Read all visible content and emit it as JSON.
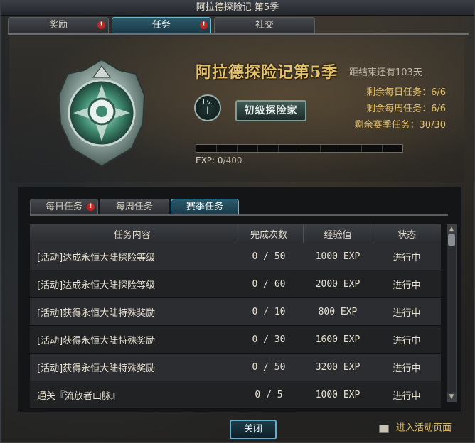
{
  "window": {
    "title": "阿拉德探险记 第5季"
  },
  "top_tabs": [
    {
      "label": "奖励",
      "alert": "!"
    },
    {
      "label": "任务",
      "alert": "!"
    },
    {
      "label": "社交"
    }
  ],
  "header": {
    "season_title": "阿拉德探险记第5季",
    "ends_in": "距结束还有103天",
    "level_label": "Lv.",
    "level_value": "I",
    "rank_name": "初级探险家",
    "remaining": [
      {
        "label": "剩余每日任务：",
        "value": "6/6"
      },
      {
        "label": "剩余每周任务：",
        "value": "6/6"
      },
      {
        "label": "剩余赛季任务：",
        "value": "30/30"
      }
    ],
    "exp_label": "EXP:",
    "exp_current": "0",
    "exp_max": "/400",
    "exp_progress": 0
  },
  "sub_tabs": [
    {
      "label": "每日任务",
      "alert": "!"
    },
    {
      "label": "每周任务"
    },
    {
      "label": "赛季任务"
    }
  ],
  "table": {
    "headers": [
      "任务内容",
      "完成次数",
      "经验值",
      "状态"
    ],
    "rows": [
      {
        "name": "[活动]达成永恒大陆探险等级",
        "count": "0 / 50",
        "exp": "1000 EXP",
        "status": "进行中"
      },
      {
        "name": "[活动]达成永恒大陆探险等级",
        "count": "0 / 60",
        "exp": "2000 EXP",
        "status": "进行中"
      },
      {
        "name": "[活动]获得永恒大陆特殊奖励",
        "count": "0 / 10",
        "exp": "800 EXP",
        "status": "进行中"
      },
      {
        "name": "[活动]获得永恒大陆特殊奖励",
        "count": "0 / 30",
        "exp": "1600 EXP",
        "status": "进行中"
      },
      {
        "name": "[活动]获得永恒大陆特殊奖励",
        "count": "0 / 50",
        "exp": "3200 EXP",
        "status": "进行中"
      },
      {
        "name": "通关『流放者山脉』",
        "count": "0 / 5",
        "exp": "1000 EXP",
        "status": "进行中"
      }
    ]
  },
  "footer": {
    "close_label": "关闭",
    "enter_label": "进入活动页面"
  },
  "colors": {
    "accent_gold": "#e5c26a",
    "status_green": "#4fd25b",
    "active_tab": "#2c5a6b",
    "alert_red": "#c0261f"
  },
  "icons": [
    "emblem-badge-icon",
    "alert-icon",
    "scroll-up-icon",
    "scroll-down-icon",
    "checkbox-icon"
  ]
}
